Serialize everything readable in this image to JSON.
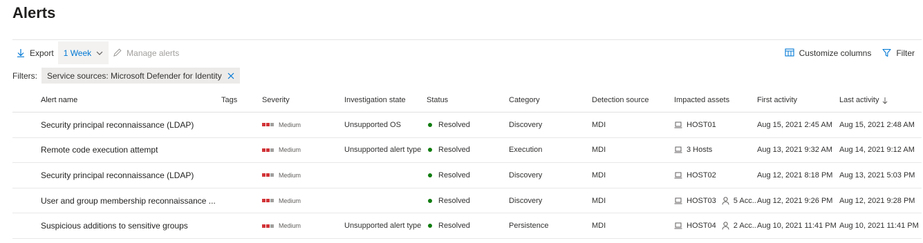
{
  "page": {
    "title": "Alerts"
  },
  "toolbar": {
    "export_label": "Export",
    "range_label": "1 Week",
    "manage_label": "Manage alerts",
    "customize_label": "Customize columns",
    "filter_label": "Filter"
  },
  "filters": {
    "label": "Filters:",
    "chip_label": "Service sources: Microsoft Defender for Identity"
  },
  "table": {
    "columns": {
      "name": "Alert name",
      "tags": "Tags",
      "severity": "Severity",
      "investigation": "Investigation state",
      "status": "Status",
      "category": "Category",
      "detection": "Detection source",
      "assets": "Impacted assets",
      "first": "First activity",
      "last": "Last activity"
    },
    "rows": [
      {
        "name": "Security principal reconnaissance (LDAP)",
        "tags": "",
        "severity": "Medium",
        "investigation": "Unsupported OS",
        "status": "Resolved",
        "category": "Discovery",
        "detection": "MDI",
        "asset_host": "HOST01",
        "asset_account": "",
        "first": "Aug 15, 2021 2:45 AM",
        "last": "Aug 15, 2021 2:48 AM"
      },
      {
        "name": "Remote code execution attempt",
        "tags": "",
        "severity": "Medium",
        "investigation": "Unsupported alert type",
        "status": "Resolved",
        "category": "Execution",
        "detection": "MDI",
        "asset_host": "3 Hosts",
        "asset_account": "",
        "first": "Aug 13, 2021 9:32 AM",
        "last": "Aug 14, 2021 9:12 AM"
      },
      {
        "name": "Security principal reconnaissance (LDAP)",
        "tags": "",
        "severity": "Medium",
        "investigation": "",
        "status": "Resolved",
        "category": "Discovery",
        "detection": "MDI",
        "asset_host": "HOST02",
        "asset_account": "",
        "first": "Aug 12, 2021 8:18 PM",
        "last": "Aug 13, 2021 5:03 PM"
      },
      {
        "name": "User and group membership reconnaissance ...",
        "tags": "",
        "severity": "Medium",
        "investigation": "",
        "status": "Resolved",
        "category": "Discovery",
        "detection": "MDI",
        "asset_host": "HOST03",
        "asset_account": "5 Acc...",
        "first": "Aug 12, 2021 9:26 PM",
        "last": "Aug 12, 2021 9:28 PM"
      },
      {
        "name": "Suspicious additions to sensitive groups",
        "tags": "",
        "severity": "Medium",
        "investigation": "Unsupported alert type",
        "status": "Resolved",
        "category": "Persistence",
        "detection": "MDI",
        "asset_host": "HOST04",
        "asset_account": "2 Acc...",
        "first": "Aug 10, 2021 11:41 PM",
        "last": "Aug 10, 2021 11:41 PM"
      }
    ]
  },
  "icons": {
    "export": "download-arrow-icon",
    "chevron": "chevron-down-icon",
    "manage": "pencil-icon",
    "customize": "columns-icon",
    "filter": "funnel-icon",
    "chip_close": "close-icon",
    "sort": "arrow-down-icon",
    "host": "laptop-icon",
    "account": "person-icon"
  },
  "colors": {
    "accent": "#0078d4",
    "severity_medium_filled": "#d13438",
    "severity_empty": "#a19f9d",
    "status_resolved": "#107c10",
    "chip_bg": "#edebe9"
  }
}
